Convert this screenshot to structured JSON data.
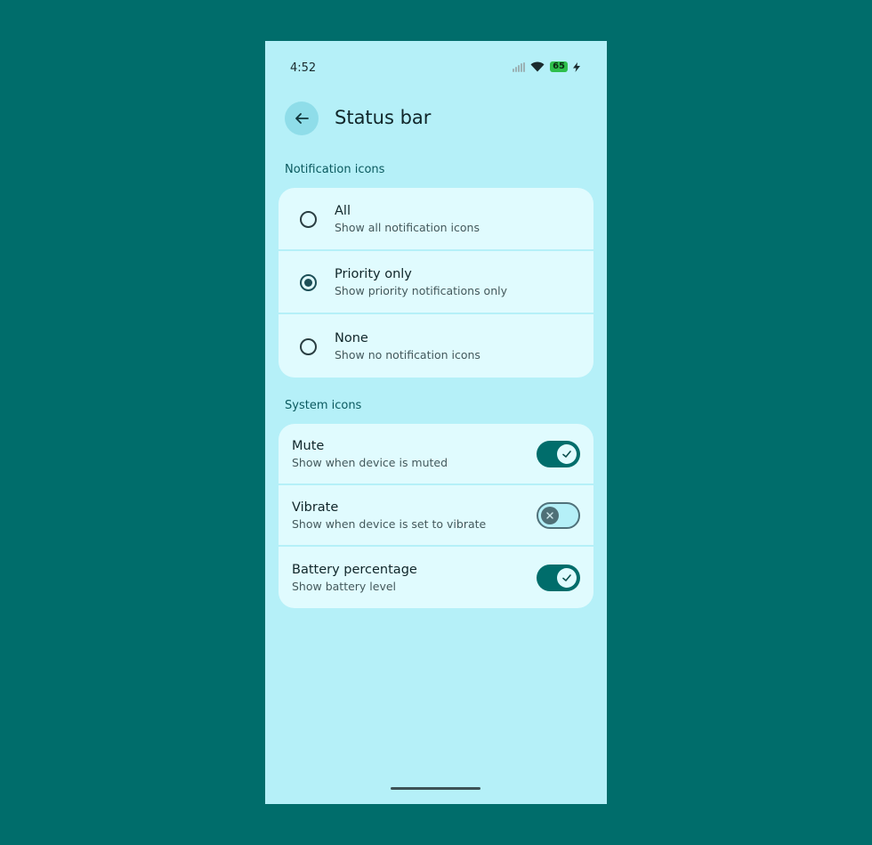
{
  "status_bar": {
    "time": "4:52",
    "battery": "65"
  },
  "header": {
    "title": "Status bar"
  },
  "notification_icons": {
    "title": "Notification icons",
    "options": [
      {
        "label": "All",
        "sub": "Show all notification icons",
        "selected": false
      },
      {
        "label": "Priority only",
        "sub": "Show priority notifications only",
        "selected": true
      },
      {
        "label": "None",
        "sub": "Show no notification icons",
        "selected": false
      }
    ]
  },
  "system_icons": {
    "title": "System icons",
    "items": [
      {
        "label": "Mute",
        "sub": "Show when device is muted",
        "on": true
      },
      {
        "label": "Vibrate",
        "sub": "Show when device is set to vibrate",
        "on": false
      },
      {
        "label": "Battery percentage",
        "sub": "Show battery level",
        "on": true
      }
    ]
  },
  "colors": {
    "background": "#006d6b",
    "surface": "#b5f0f8",
    "card": "#e0fbfe",
    "accent": "#006d6b"
  }
}
